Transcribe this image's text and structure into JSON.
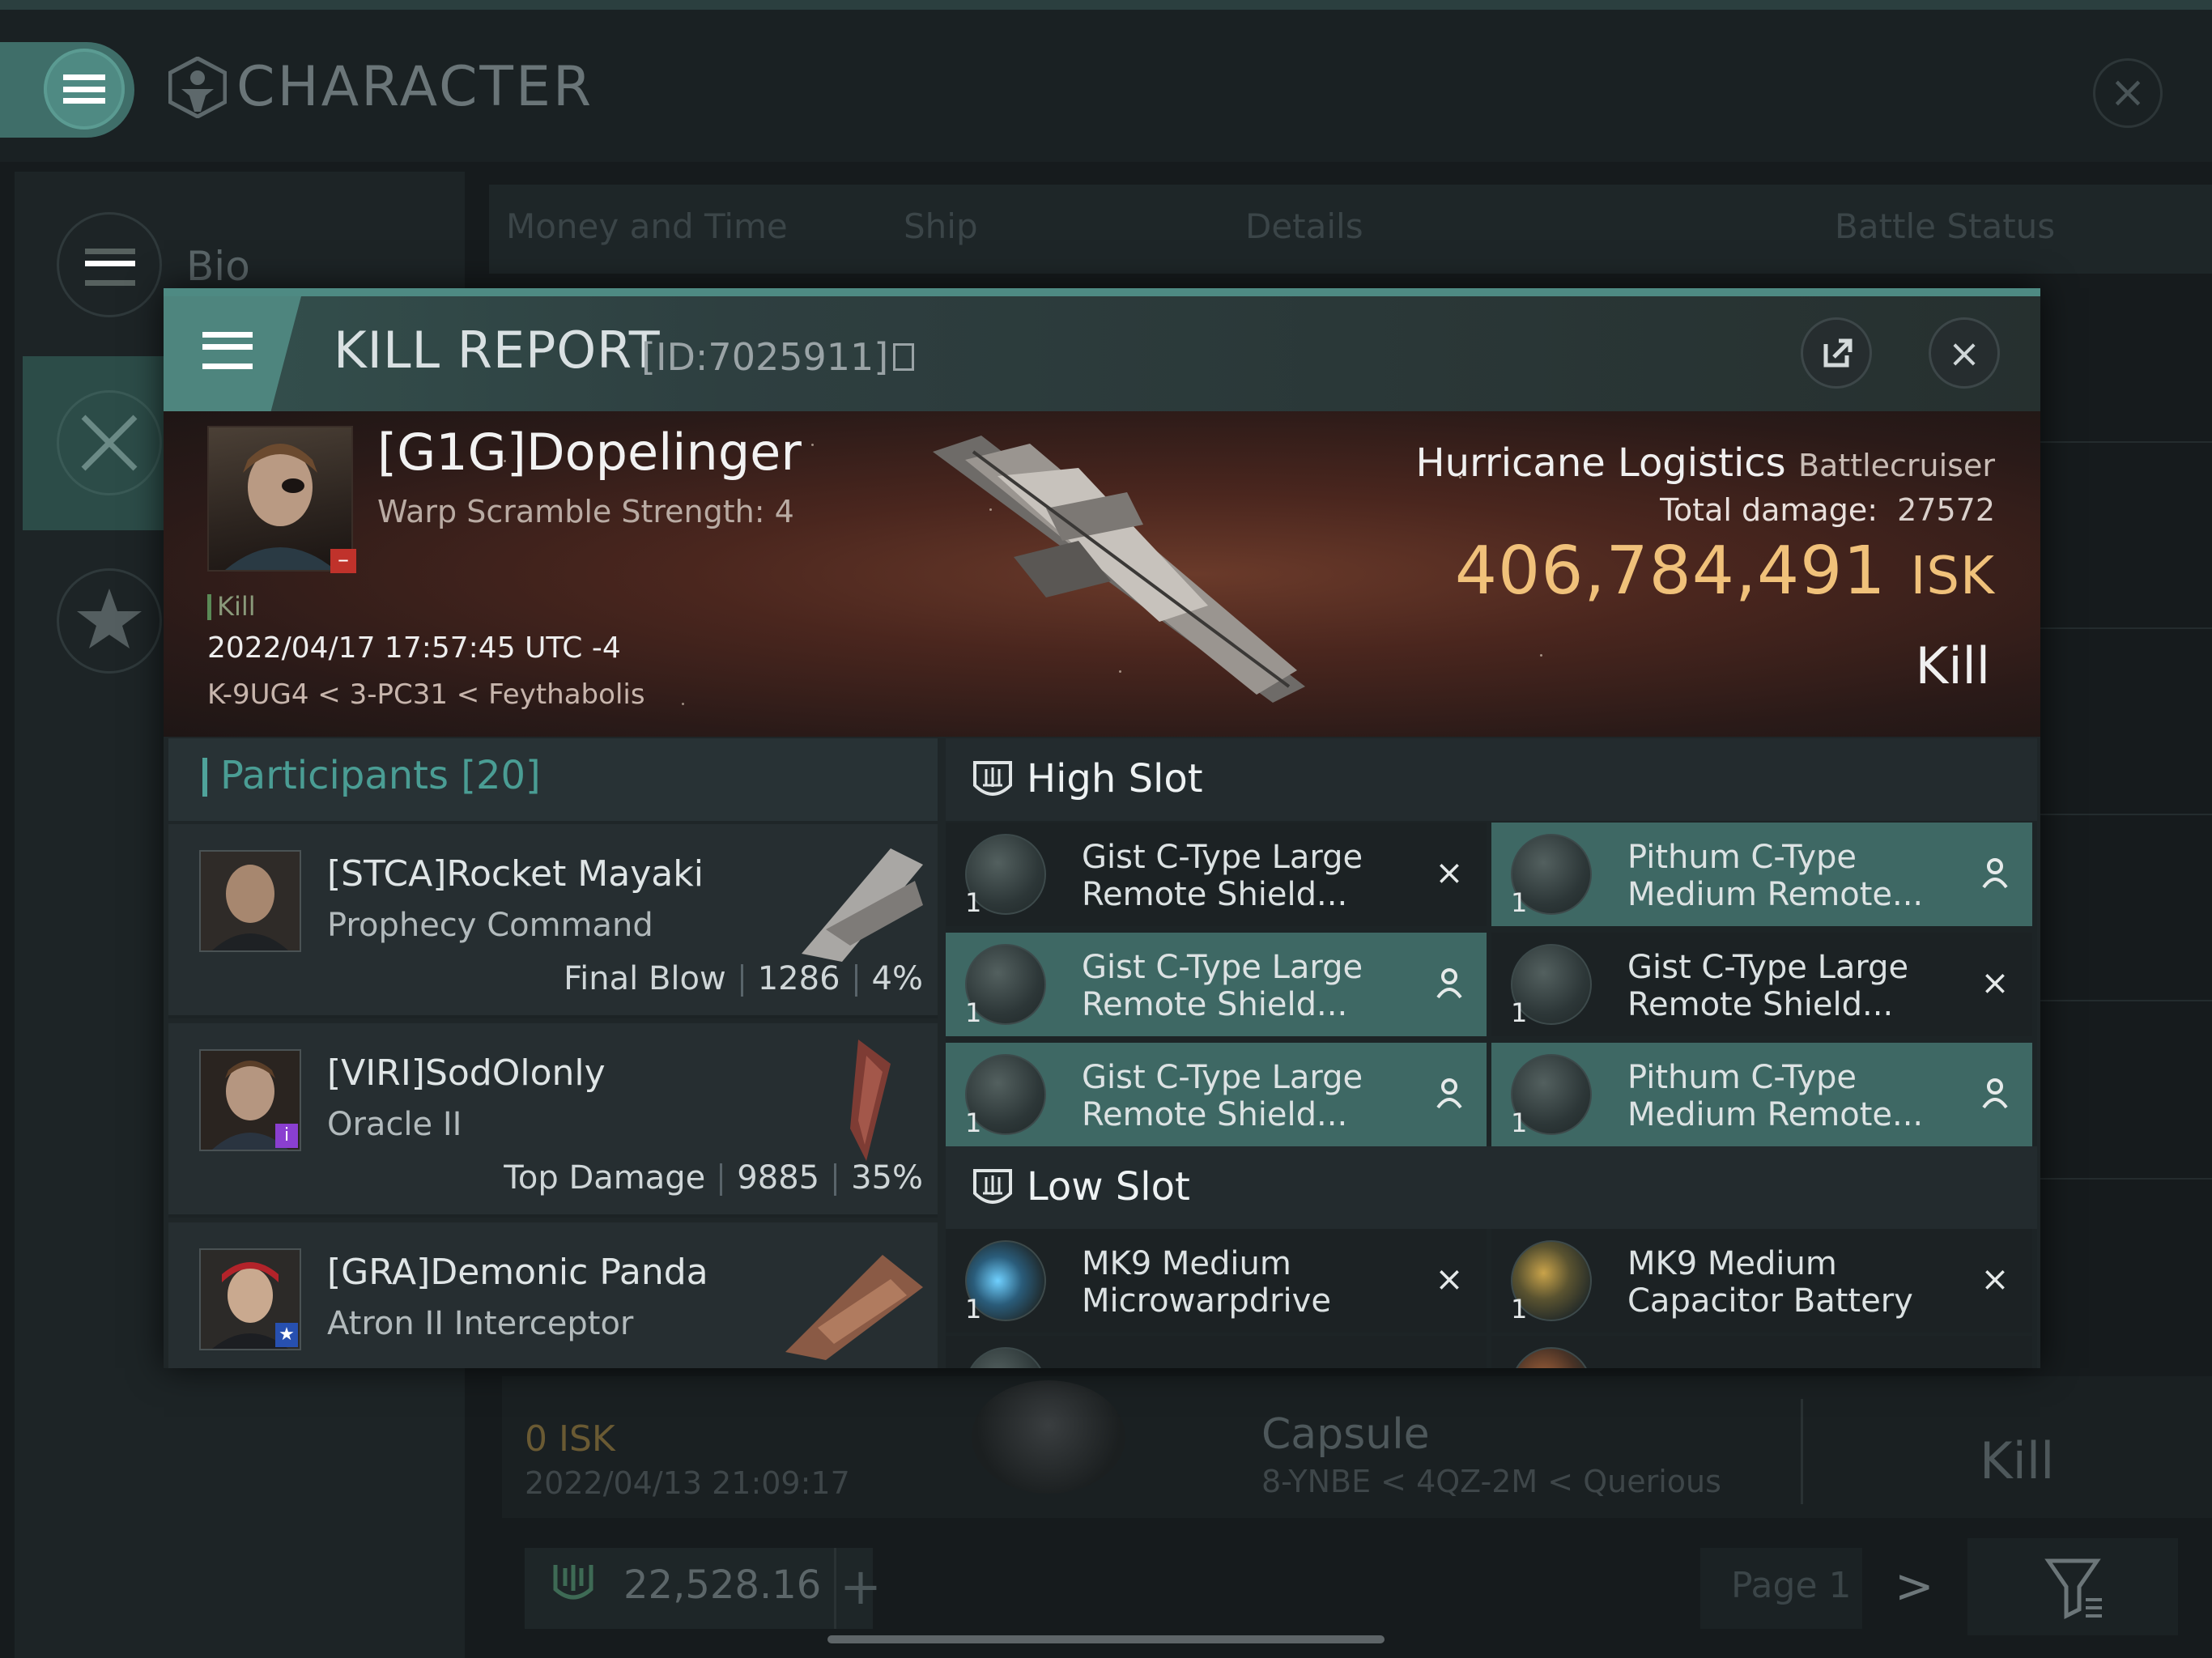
{
  "character_screen": {
    "title": "CHARACTER",
    "sidebar": {
      "bio_label": "Bio"
    },
    "tabs": [
      "Money and Time",
      "Ship",
      "Details",
      "Battle Status"
    ],
    "background_kill": {
      "isk": "0 ISK",
      "date": "2022/04/13 21:09:17",
      "ship": "Capsule",
      "location": "8-YNBE < 4QZ-2M < Querious",
      "result": "Kill"
    },
    "wallet": {
      "amount": "22,528.16",
      "plus": "+"
    },
    "pagination": {
      "page_label": "Page 1",
      "next": ">"
    }
  },
  "kill_report": {
    "title": "KILL REPORT",
    "id_label": "[ID:7025911]",
    "victim": {
      "name": "[G1G]Dopelinger",
      "warp_scramble": "Warp Scramble Strength: 4",
      "tag": "Kill",
      "date": "2022/04/17 17:57:45 UTC -4",
      "location": "K-9UG4 < 3-PC31 < Feythabolis"
    },
    "ship": {
      "name": "Hurricane Logistics",
      "class": "Battlecruiser",
      "total_damage_label": "Total damage:",
      "total_damage": "27572",
      "isk_value": "406,784,491",
      "isk_unit": "ISK",
      "result": "Kill"
    },
    "participants": {
      "label": "Participants",
      "count": "[20]",
      "items": [
        {
          "name": "[STCA]Rocket Mayaki",
          "ship": "Prophecy Command",
          "role": "Final Blow",
          "damage": "1286",
          "percent": "4%"
        },
        {
          "name": "[VIRI]SodOlonly",
          "ship": "Oracle II",
          "role": "Top Damage",
          "damage": "9885",
          "percent": "35%"
        },
        {
          "name": "[GRA]Demonic Panda",
          "ship": "Atron II Interceptor",
          "role": "",
          "damage": "",
          "percent": ""
        }
      ]
    },
    "high_slot": {
      "label": "High Slot",
      "modules": [
        {
          "name_line1": "Gist C-Type Large",
          "name_line2": "Remote Shield...",
          "qty": "1",
          "state": "destroyed",
          "state_icon": "×"
        },
        {
          "name_line1": "Pithum C-Type",
          "name_line2": "Medium Remote...",
          "qty": "1",
          "state": "dropped",
          "state_icon": "person"
        },
        {
          "name_line1": "Gist C-Type Large",
          "name_line2": "Remote Shield...",
          "qty": "1",
          "state": "dropped",
          "state_icon": "person"
        },
        {
          "name_line1": "Gist C-Type Large",
          "name_line2": "Remote Shield...",
          "qty": "1",
          "state": "destroyed",
          "state_icon": "×"
        },
        {
          "name_line1": "Gist C-Type Large",
          "name_line2": "Remote Shield...",
          "qty": "1",
          "state": "dropped",
          "state_icon": "person"
        },
        {
          "name_line1": "Pithum C-Type",
          "name_line2": "Medium Remote...",
          "qty": "1",
          "state": "dropped",
          "state_icon": "person"
        }
      ]
    },
    "low_slot": {
      "label": "Low Slot",
      "modules": [
        {
          "name_line1": "MK9 Medium",
          "name_line2": "Microwarpdrive",
          "qty": "1",
          "state": "destroyed",
          "state_icon": "×"
        },
        {
          "name_line1": "MK9 Medium",
          "name_line2": "Capacitor Battery",
          "qty": "1",
          "state": "destroyed",
          "state_icon": "×"
        }
      ]
    }
  },
  "colors": {
    "accent_teal": "#4e8a83",
    "isk_gold": "#f0c17a",
    "dropped_module_bg": "#3e6864",
    "banner_red": "#6a3a2a"
  }
}
